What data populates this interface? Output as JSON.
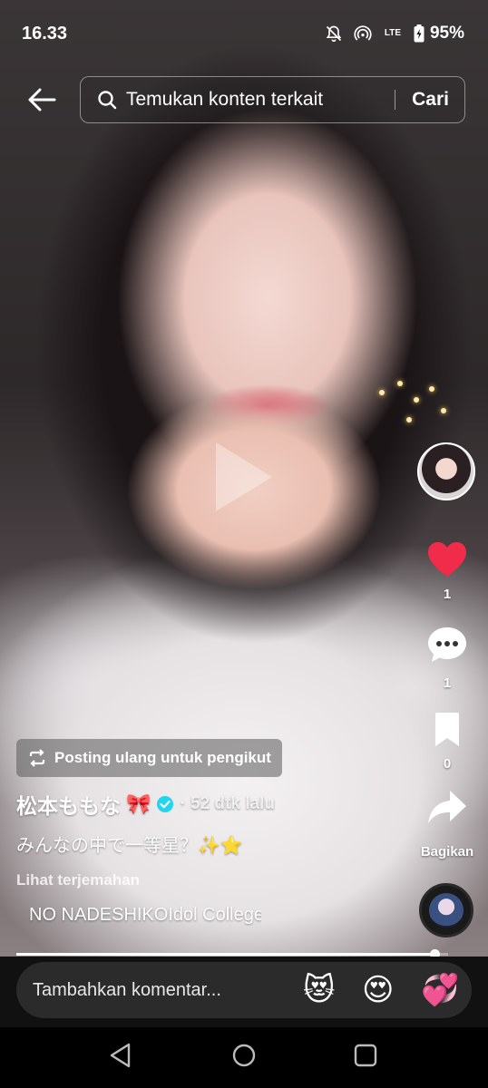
{
  "status_bar": {
    "time": "16.33",
    "network": "LTE",
    "battery": "95%",
    "icons": [
      "mute-icon",
      "hotspot-icon",
      "lte-signal-icon",
      "battery-icon"
    ]
  },
  "search": {
    "query": "Temukan konten terkait",
    "submit_label": "Cari"
  },
  "actions": {
    "like_count": "1",
    "comment_count": "1",
    "save_count": "0",
    "share_label": "Bagikan"
  },
  "post": {
    "repost_label": "Posting ulang untuk pengikut",
    "author": "松本ももな",
    "author_emoji": "🎀",
    "time_ago": "· 52 dtk lalu",
    "caption": "みんなの中で一等星？✨⭐",
    "translate_label": "Lihat terjemahan",
    "music_title": "NO NADESHIKO",
    "music_artist": "Idol College"
  },
  "progress": {
    "fraction": 0.97
  },
  "comment": {
    "placeholder": "Tambahkan komentar...",
    "emojis": [
      "😻",
      "😍",
      "💞"
    ]
  },
  "colors": {
    "like_red": "#f12b4a",
    "verified_blue": "#20d5ec"
  }
}
